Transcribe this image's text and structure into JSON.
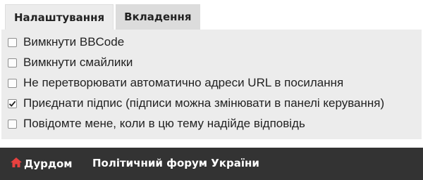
{
  "tabs": [
    {
      "label": "Налаштування",
      "active": true
    },
    {
      "label": "Вкладення",
      "active": false
    }
  ],
  "options": [
    {
      "label": "Вимкнути BBCode",
      "checked": false
    },
    {
      "label": "Вимкнути смайлики",
      "checked": false
    },
    {
      "label": "Не перетворювати автоматично адреси URL в посилання",
      "checked": false
    },
    {
      "label": "Приєднати підпис (підписи можна змінювати в панелі керування)",
      "checked": true
    },
    {
      "label": "Повідомте мене, коли в цю тему надійде відповідь",
      "checked": false
    }
  ],
  "footer": {
    "home_label": "Дурдом",
    "home_icon": "home-icon",
    "forum_label": "Політичний форум України"
  },
  "colors": {
    "footer_bg": "#333333",
    "home_icon": "#e8413f",
    "panel_bg": "#ececec"
  }
}
